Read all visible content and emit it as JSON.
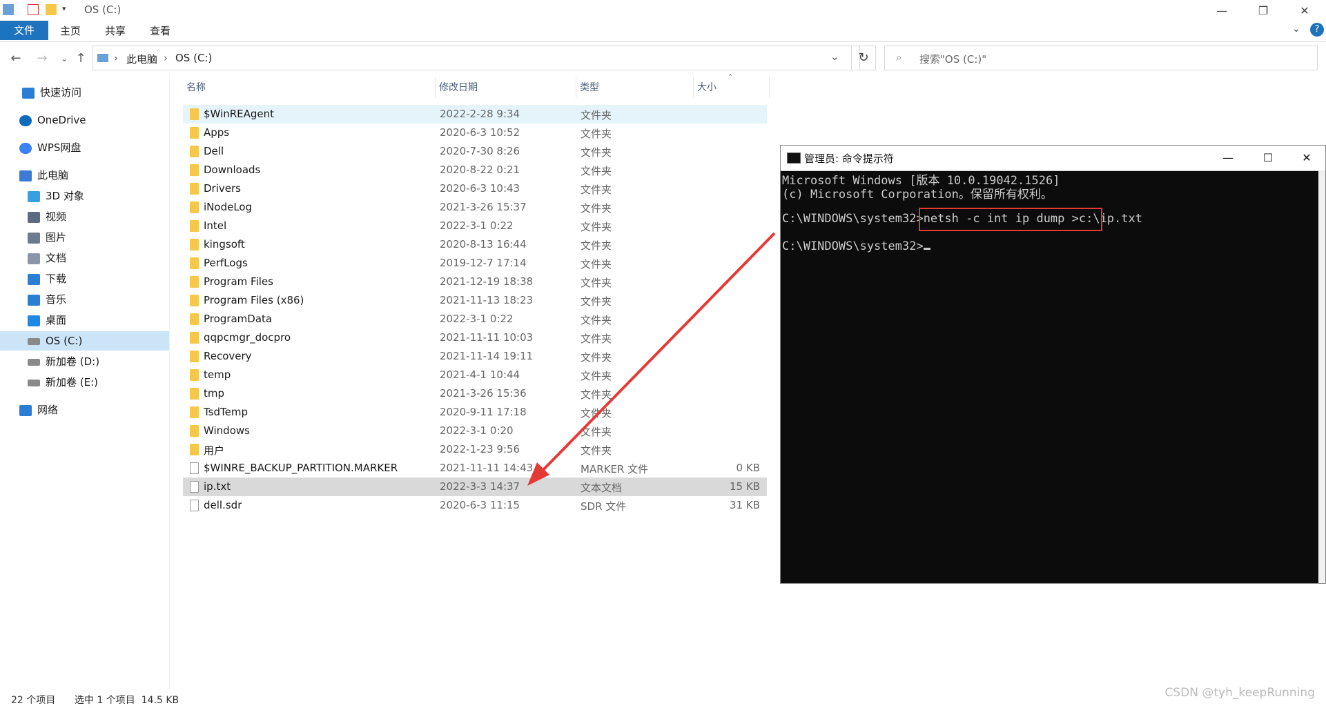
{
  "window": {
    "title": "OS (C:)",
    "minimize": "—",
    "restore": "❐",
    "close": "✕"
  },
  "ribbon": {
    "tabs": [
      "文件",
      "主页",
      "共享",
      "查看"
    ],
    "help": "?"
  },
  "address": {
    "crumbs": [
      "此电脑",
      "OS (C:)"
    ],
    "search_placeholder": "搜索\"OS (C:)\""
  },
  "sidebar": {
    "items": [
      {
        "label": "快速访问",
        "icon": "star-icon",
        "color": "#2a7fd4"
      },
      {
        "label": "OneDrive",
        "icon": "cloud-icon",
        "color": "#0f6cbd"
      },
      {
        "label": "WPS网盘",
        "icon": "cloud-icon",
        "color": "#3b82f6"
      },
      {
        "label": "此电脑",
        "icon": "computer-icon",
        "color": "#3a7bd5"
      },
      {
        "label": "3D 对象",
        "icon": "cube-icon",
        "color": "#39a0e0"
      },
      {
        "label": "视频",
        "icon": "film-icon",
        "color": "#5a6b82"
      },
      {
        "label": "图片",
        "icon": "picture-icon",
        "color": "#6b7b90"
      },
      {
        "label": "文档",
        "icon": "document-icon",
        "color": "#8a96a8"
      },
      {
        "label": "下载",
        "icon": "download-icon",
        "color": "#2a7fd4"
      },
      {
        "label": "音乐",
        "icon": "music-icon",
        "color": "#2a7fd4"
      },
      {
        "label": "桌面",
        "icon": "desktop-icon",
        "color": "#1e88e5"
      },
      {
        "label": "OS (C:)",
        "icon": "drive-icon",
        "color": "#8a8a8a"
      },
      {
        "label": "新加卷 (D:)",
        "icon": "drive-icon",
        "color": "#8a8a8a"
      },
      {
        "label": "新加卷 (E:)",
        "icon": "drive-icon",
        "color": "#8a8a8a"
      },
      {
        "label": "网络",
        "icon": "network-icon",
        "color": "#2a7fd4"
      }
    ]
  },
  "columns": {
    "name": "名称",
    "date": "修改日期",
    "type": "类型",
    "size": "大小"
  },
  "files": [
    {
      "name": "$WinREAgent",
      "date": "2022-2-28 9:34",
      "type": "文件夹",
      "size": ""
    },
    {
      "name": "Apps",
      "date": "2020-6-3 10:52",
      "type": "文件夹",
      "size": ""
    },
    {
      "name": "Dell",
      "date": "2020-7-30 8:26",
      "type": "文件夹",
      "size": ""
    },
    {
      "name": "Downloads",
      "date": "2020-8-22 0:21",
      "type": "文件夹",
      "size": ""
    },
    {
      "name": "Drivers",
      "date": "2020-6-3 10:43",
      "type": "文件夹",
      "size": ""
    },
    {
      "name": "iNodeLog",
      "date": "2021-3-26 15:37",
      "type": "文件夹",
      "size": ""
    },
    {
      "name": "Intel",
      "date": "2022-3-1 0:22",
      "type": "文件夹",
      "size": ""
    },
    {
      "name": "kingsoft",
      "date": "2020-8-13 16:44",
      "type": "文件夹",
      "size": ""
    },
    {
      "name": "PerfLogs",
      "date": "2019-12-7 17:14",
      "type": "文件夹",
      "size": ""
    },
    {
      "name": "Program Files",
      "date": "2021-12-19 18:38",
      "type": "文件夹",
      "size": ""
    },
    {
      "name": "Program Files (x86)",
      "date": "2021-11-13 18:23",
      "type": "文件夹",
      "size": ""
    },
    {
      "name": "ProgramData",
      "date": "2022-3-1 0:22",
      "type": "文件夹",
      "size": ""
    },
    {
      "name": "qqpcmgr_docpro",
      "date": "2021-11-11 10:03",
      "type": "文件夹",
      "size": ""
    },
    {
      "name": "Recovery",
      "date": "2021-11-14 19:11",
      "type": "文件夹",
      "size": ""
    },
    {
      "name": "temp",
      "date": "2021-4-1 10:44",
      "type": "文件夹",
      "size": ""
    },
    {
      "name": "tmp",
      "date": "2021-3-26 15:36",
      "type": "文件夹",
      "size": ""
    },
    {
      "name": "TsdTemp",
      "date": "2020-9-11 17:18",
      "type": "文件夹",
      "size": ""
    },
    {
      "name": "Windows",
      "date": "2022-3-1 0:20",
      "type": "文件夹",
      "size": ""
    },
    {
      "name": "用户",
      "date": "2022-1-23 9:56",
      "type": "文件夹",
      "size": ""
    },
    {
      "name": "$WINRE_BACKUP_PARTITION.MARKER",
      "date": "2021-11-11 14:43",
      "type": "MARKER 文件",
      "size": "0 KB"
    },
    {
      "name": "ip.txt",
      "date": "2022-3-3 14:37",
      "type": "文本文档",
      "size": "15 KB"
    },
    {
      "name": "dell.sdr",
      "date": "2020-6-3 11:15",
      "type": "SDR 文件",
      "size": "31 KB"
    }
  ],
  "status": {
    "count": "22 个项目",
    "selected": "选中 1 个项目  14.5 KB"
  },
  "cmd": {
    "title": "管理员: 命令提示符",
    "lines": [
      "Microsoft Windows [版本 10.0.19042.1526]",
      "(c) Microsoft Corporation。保留所有权利。",
      "",
      "C:\\WINDOWS\\system32>netsh -c int ip dump >c:\\ip.txt",
      "",
      "C:\\WINDOWS\\system32>"
    ],
    "highlight_color": "#e53935"
  },
  "watermark": "CSDN @tyh_keepRunning"
}
